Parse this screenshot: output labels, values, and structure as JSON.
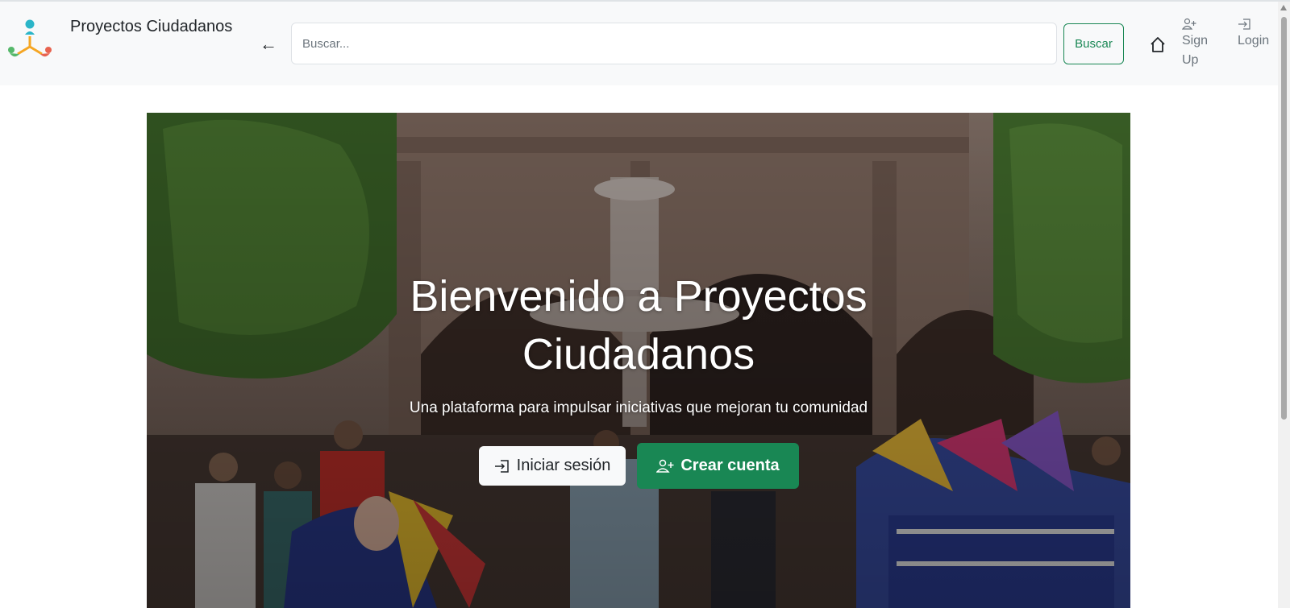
{
  "navbar": {
    "brand": "Proyectos Ciudadanos",
    "back_icon": "arrow-left-icon",
    "search": {
      "placeholder": "Buscar...",
      "value": ""
    },
    "search_button": "Buscar",
    "home_icon": "house-icon",
    "signup": {
      "line1": "Sign",
      "line2": "Up",
      "icon": "person-plus-icon"
    },
    "login": {
      "label": "Login",
      "icon": "box-arrow-in-right-icon"
    }
  },
  "hero": {
    "title_line1": "Bienvenido a Proyectos",
    "title_line2": "Ciudadanos",
    "subtitle": "Una plataforma para impulsar iniciativas que mejoran tu comunidad",
    "login_button": {
      "label": "Iniciar sesión",
      "icon": "box-arrow-in-right-icon"
    },
    "create_button": {
      "label": "Crear cuenta",
      "icon": "person-plus-icon"
    }
  },
  "colors": {
    "primary_green": "#198754",
    "navbar_bg": "#f8f9fa",
    "muted_text": "#6c757d",
    "logo_teal": "#2bb5c8",
    "logo_green": "#55b86a",
    "logo_orange": "#f5a623",
    "logo_red": "#e8634f"
  }
}
